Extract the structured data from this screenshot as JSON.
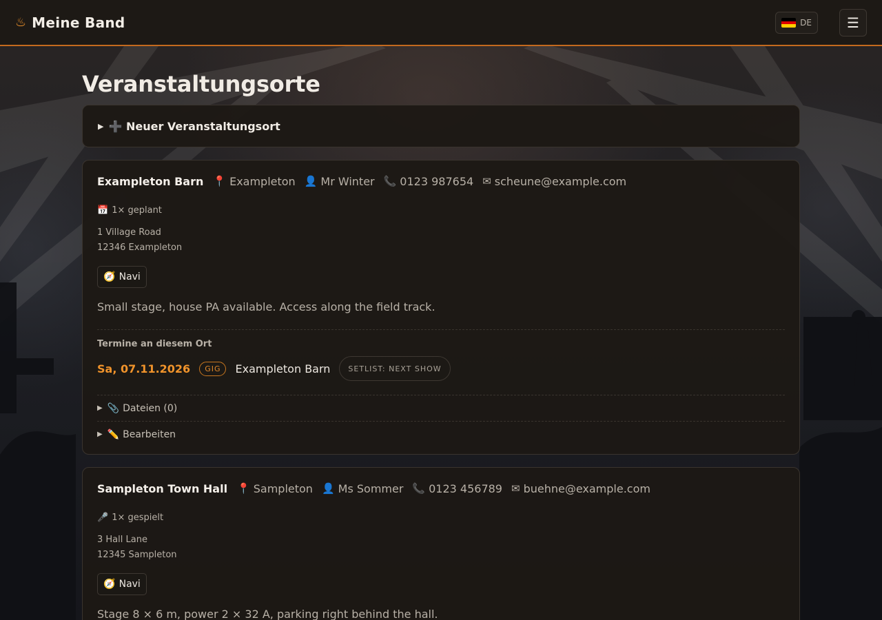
{
  "header": {
    "brand_icon": "♨",
    "brand": "Meine Band",
    "lang_label": "DE",
    "menu_icon": "☰"
  },
  "page": {
    "title": "Veranstaltungsorte",
    "new_venue_label": "➕ Neuer Veranstaltungsort"
  },
  "venues": [
    {
      "name": "Exampleton Barn",
      "city": "Exampleton",
      "contact": "Mr Winter",
      "phone": "0123 987654",
      "email": "scheune@example.com",
      "stat_icon": "📅",
      "stat": "1× geplant",
      "address_line1": "1 Village Road",
      "address_line2": "12346 Exampleton",
      "navi_label": "Navi",
      "notes": "Small stage, house PA available. Access along the field track.",
      "termine_title": "Termine an diesem Ort",
      "event": {
        "date": "Sa, 07.11.2026",
        "type": "GIG",
        "venue": "Exampleton Barn",
        "setlist": "SETLIST: NEXT SHOW"
      },
      "files_label": "Dateien (0)",
      "edit_label": "Bearbeiten"
    },
    {
      "name": "Sampleton Town Hall",
      "city": "Sampleton",
      "contact": "Ms Sommer",
      "phone": "0123 456789",
      "email": "buehne@example.com",
      "stat_icon": "🎤",
      "stat": "1× gespielt",
      "address_line1": "3 Hall Lane",
      "address_line2": "12345 Sampleton",
      "navi_label": "Navi",
      "notes": "Stage 8 × 6 m, power 2 × 32 A, parking right behind the hall."
    }
  ],
  "icons": {
    "pin": "pin-icon",
    "person": "person-icon",
    "phone": "phone-icon",
    "mail": "mail-icon",
    "compass": "compass-icon",
    "paperclip": "paperclip-icon",
    "pencil": "pencil-icon"
  },
  "colors": {
    "accent": "#f0932b",
    "header_border": "#c46a1e",
    "card_bg": "#1d1915",
    "flag_black": "#000000",
    "flag_red": "#dd0000",
    "flag_gold": "#ffce00"
  }
}
